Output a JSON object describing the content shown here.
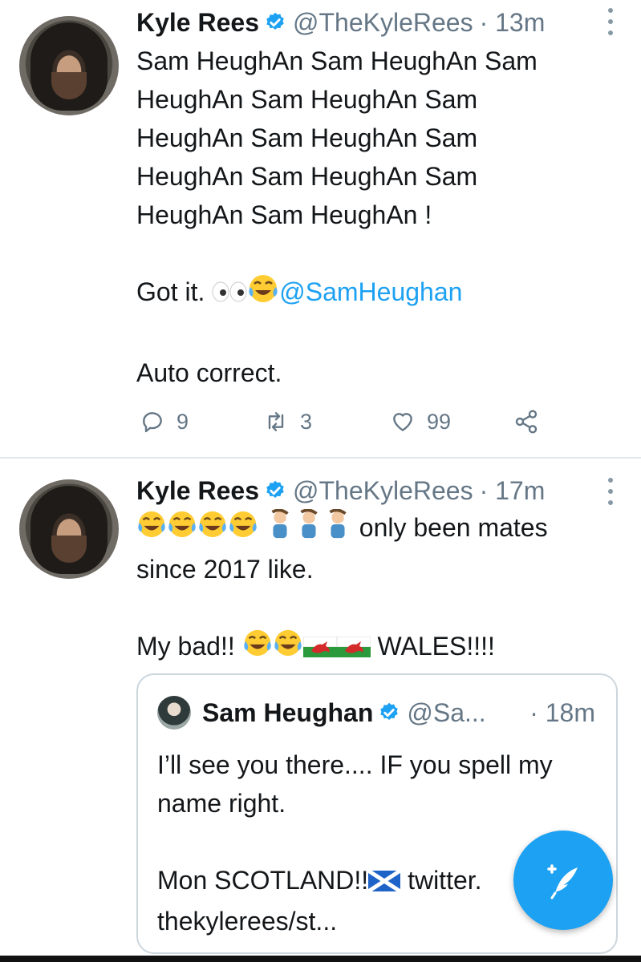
{
  "tweets": [
    {
      "name": "Kyle Rees",
      "handle": "@TheKyleRees",
      "time": "· 13m",
      "lines": [
        "Sam HeughAn Sam HeughAn Sam",
        "HeughAn Sam HeughAn Sam",
        "HeughAn Sam HeughAn Sam",
        "HeughAn Sam HeughAn Sam",
        "HeughAn Sam HeughAn !"
      ],
      "got_it": "Got it.",
      "mention": "@SamHeughan",
      "auto_correct": "Auto correct.",
      "reply_count": "9",
      "retweet_count": "3",
      "like_count": "99"
    },
    {
      "name": "Kyle Rees",
      "handle": "@TheKyleRees",
      "time": "· 17m",
      "line1_text": "only been mates",
      "line2": "since 2017 like.",
      "line3_a": "My bad!!",
      "line3_b": "WALES!!!!"
    }
  ],
  "quote": {
    "name": "Sam Heughan",
    "handle": "@Sa...",
    "time": "· 18m",
    "line1": "I’ll see you there.... IF you spell my",
    "line2": "name right.",
    "line3_a": "Mon SCOTLAND!!",
    "line3_b": "twitter.",
    "line4": "thekylerees/st..."
  },
  "icons": {
    "verified": "verified-badge-icon",
    "reply": "reply-icon",
    "retweet": "retweet-icon",
    "like": "heart-icon",
    "share": "share-icon",
    "compose": "compose-tweet-icon"
  },
  "colors": {
    "accent": "#1da1f2",
    "muted": "#657786",
    "divider": "#e1e8ed"
  }
}
